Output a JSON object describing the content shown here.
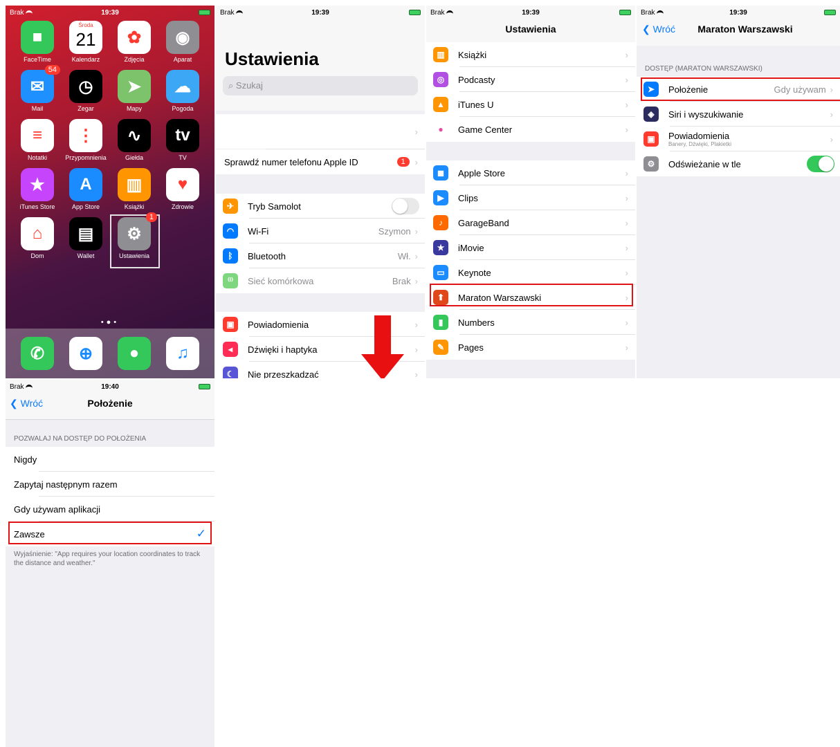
{
  "status": {
    "carrier": "Brak",
    "time1": "19:39",
    "time2": "19:40"
  },
  "home": {
    "apps": [
      {
        "label": "FaceTime",
        "icon": "facetime-icon",
        "color": "#34c759"
      },
      {
        "label": "Kalendarz",
        "icon": "calendar-icon",
        "color": "#ffffff",
        "day": "Środa",
        "date": "21"
      },
      {
        "label": "Zdjęcia",
        "icon": "photos-icon",
        "color": "#ffffff"
      },
      {
        "label": "Aparat",
        "icon": "camera-icon",
        "color": "#8e8e93"
      },
      {
        "label": "Mail",
        "icon": "mail-icon",
        "color": "#1e90ff",
        "badge": "54"
      },
      {
        "label": "Zegar",
        "icon": "clock-icon",
        "color": "#000000"
      },
      {
        "label": "Mapy",
        "icon": "maps-icon",
        "color": "#7cc36b"
      },
      {
        "label": "Pogoda",
        "icon": "weather-icon",
        "color": "#3ba7f5"
      },
      {
        "label": "Notatki",
        "icon": "notes-icon",
        "color": "#ffffff"
      },
      {
        "label": "Przypomnienia",
        "icon": "reminders-icon",
        "color": "#ffffff"
      },
      {
        "label": "Giełda",
        "icon": "stocks-icon",
        "color": "#000000"
      },
      {
        "label": "TV",
        "icon": "tv-icon",
        "color": "#000000",
        "glyph": "tv"
      },
      {
        "label": "iTunes Store",
        "icon": "itunes-store-icon",
        "color": "#c644fc"
      },
      {
        "label": "App Store",
        "icon": "app-store-icon",
        "color": "#1a8cff"
      },
      {
        "label": "Książki",
        "icon": "books-icon",
        "color": "#ff9500"
      },
      {
        "label": "Zdrowie",
        "icon": "health-icon",
        "color": "#ffffff"
      },
      {
        "label": "Dom",
        "icon": "home-app-icon",
        "color": "#ffffff"
      },
      {
        "label": "Wallet",
        "icon": "wallet-icon",
        "color": "#000000"
      },
      {
        "label": "Ustawienia",
        "icon": "settings-icon",
        "color": "#8e8e93",
        "badge": "1"
      }
    ],
    "dock": [
      {
        "icon": "phone-icon",
        "color": "#34c759"
      },
      {
        "icon": "safari-icon",
        "color": "#ffffff"
      },
      {
        "icon": "messages-icon",
        "color": "#34c759"
      },
      {
        "icon": "music-icon",
        "color": "#ffffff"
      }
    ]
  },
  "settings": {
    "title": "Ustawienia",
    "search_placeholder": "Szukaj",
    "apple_id_row": "Sprawdź numer telefonu Apple ID",
    "apple_id_badge": "1",
    "rows1": [
      {
        "label": "Tryb Samolot",
        "icon": "airplane-icon",
        "color": "#ff9500",
        "toggle": "off"
      },
      {
        "label": "Wi-Fi",
        "value": "Szymon",
        "icon": "wifi-icon",
        "color": "#007aff"
      },
      {
        "label": "Bluetooth",
        "value": "Wł.",
        "icon": "bluetooth-icon",
        "color": "#007aff"
      },
      {
        "label": "Sieć komórkowa",
        "value": "Brak",
        "icon": "cellular-icon",
        "color": "#7ed67e",
        "disabled": true
      }
    ],
    "rows2": [
      {
        "label": "Powiadomienia",
        "icon": "notifications-icon",
        "color": "#ff3b30"
      },
      {
        "label": "Dźwięki i haptyka",
        "icon": "sounds-icon",
        "color": "#ff2d55"
      },
      {
        "label": "Nie przeszkadzać",
        "icon": "moon-icon",
        "color": "#5856d6"
      }
    ]
  },
  "apps_list": {
    "title": "Ustawienia",
    "group1": [
      {
        "label": "Książki",
        "icon": "books-icon",
        "color": "#ff9500"
      },
      {
        "label": "Podcasty",
        "icon": "podcasts-icon",
        "color": "#b150e2"
      },
      {
        "label": "iTunes U",
        "icon": "itunes-u-icon",
        "color": "#ff9500"
      },
      {
        "label": "Game Center",
        "icon": "game-center-icon",
        "color": "#ffffff"
      }
    ],
    "group2": [
      {
        "label": "Apple Store",
        "icon": "apple-store-icon",
        "color": "#1a8cff"
      },
      {
        "label": "Clips",
        "icon": "clips-icon",
        "color": "#1a8cff"
      },
      {
        "label": "GarageBand",
        "icon": "garageband-icon",
        "color": "#ff6a00"
      },
      {
        "label": "iMovie",
        "icon": "imovie-icon",
        "color": "#3a3a9e"
      },
      {
        "label": "Keynote",
        "icon": "keynote-icon",
        "color": "#1a8cff"
      },
      {
        "label": "Maraton Warszawski",
        "icon": "maraton-icon",
        "color": "#e0471a"
      },
      {
        "label": "Numbers",
        "icon": "numbers-icon",
        "color": "#34c759"
      },
      {
        "label": "Pages",
        "icon": "pages-icon",
        "color": "#ff9500"
      }
    ]
  },
  "maraton": {
    "back": "Wróć",
    "title": "Maraton Warszawski",
    "section": "DOSTĘP (MARATON WARSZAWSKI)",
    "rows": [
      {
        "label": "Położenie",
        "value": "Gdy używam",
        "icon": "location-arrow-icon",
        "color": "#007aff"
      },
      {
        "label": "Siri i wyszukiwanie",
        "icon": "siri-icon",
        "color": "#2b2b5e"
      },
      {
        "label": "Powiadomienia",
        "sub": "Banery, Dźwięki, Plakietki",
        "icon": "notifications-icon",
        "color": "#ff3b30"
      },
      {
        "label": "Odświeżanie w tle",
        "icon": "gear-icon",
        "color": "#8e8e93",
        "toggle": "on"
      }
    ]
  },
  "location": {
    "back": "Wróć",
    "title": "Położenie",
    "section": "POZWALAJ NA DOSTĘP DO POŁOŻENIA",
    "options": [
      "Nigdy",
      "Zapytaj następnym razem",
      "Gdy używam aplikacji",
      "Zawsze"
    ],
    "selected": "Zawsze",
    "note": "Wyjaśnienie: \"App requires your location coordinates to track the distance and weather.\""
  }
}
